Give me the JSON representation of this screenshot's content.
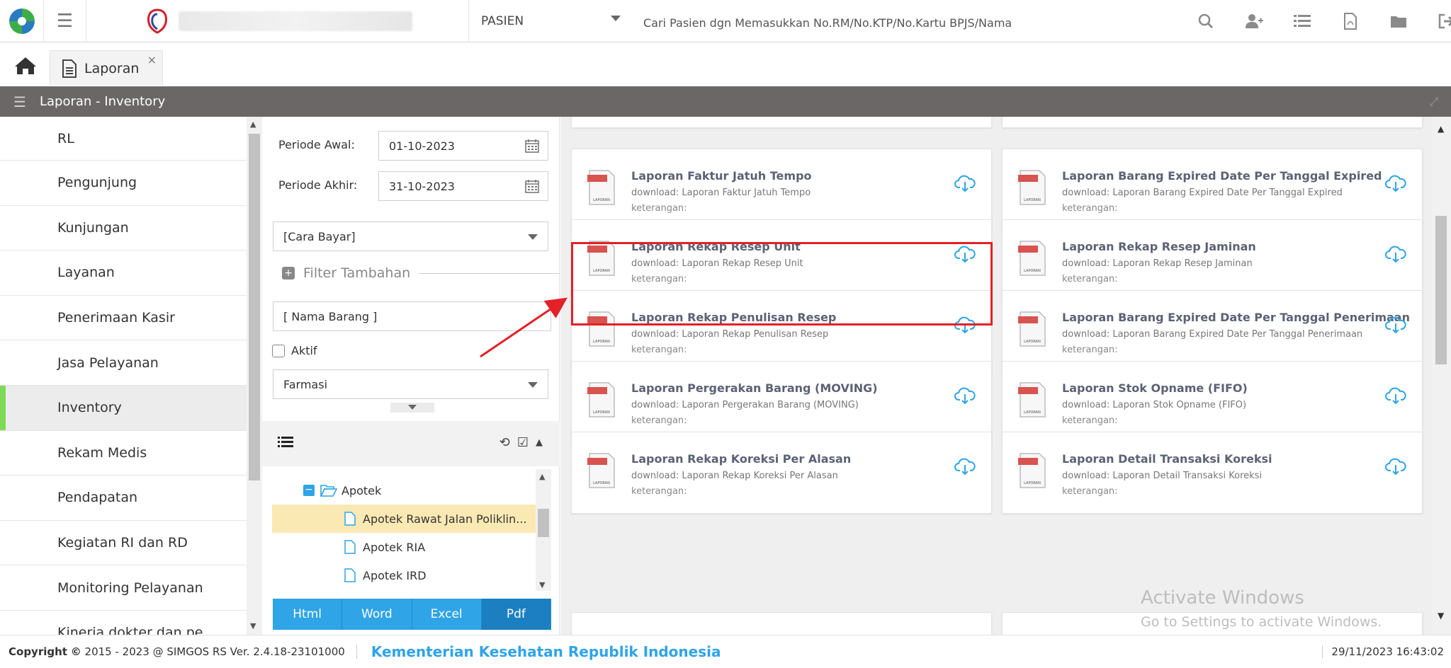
{
  "topbar": {
    "patient_select": "PASIEN",
    "search_placeholder": "Cari Pasien dgn Memasukkan No.RM/No.KTP/No.Kartu BPJS/Nama",
    "icons": [
      "search-icon",
      "add-user-icon",
      "list-icon",
      "pdf-file-icon",
      "folder-icon",
      "logout-icon"
    ]
  },
  "tabs": [
    {
      "label": "Laporan",
      "close": "×"
    }
  ],
  "section": {
    "title": "Laporan - Inventory"
  },
  "sidebar": {
    "items": [
      {
        "label": "RL"
      },
      {
        "label": "Pengunjung"
      },
      {
        "label": "Kunjungan"
      },
      {
        "label": "Layanan"
      },
      {
        "label": "Penerimaan Kasir"
      },
      {
        "label": "Jasa Pelayanan"
      },
      {
        "label": "Inventory"
      },
      {
        "label": "Rekam Medis"
      },
      {
        "label": "Pendapatan"
      },
      {
        "label": "Kegiatan RI dan RD"
      },
      {
        "label": "Monitoring Pelayanan"
      },
      {
        "label": "Kinerja dokter dan pe..."
      }
    ],
    "active": "Inventory"
  },
  "filter": {
    "periode_awal_label": "Periode Awal:",
    "periode_awal_value": "01-10-2023",
    "periode_akhir_label": "Periode Akhir:",
    "periode_akhir_value": "31-10-2023",
    "cara_bayar": "[Cara Bayar]",
    "filter_tambahan": "Filter Tambahan",
    "nama_barang_placeholder": "[ Nama Barang ]",
    "aktif_label": "Aktif",
    "farmasi": "Farmasi",
    "tree": [
      {
        "label": "Apotek",
        "type": "folder"
      },
      {
        "label": "Apotek Rawat Jalan Poliklin...",
        "type": "file",
        "selected": true
      },
      {
        "label": "Apotek RIA",
        "type": "file"
      },
      {
        "label": "Apotek IRD",
        "type": "file"
      }
    ],
    "buttons": [
      "Html",
      "Word",
      "Excel",
      "Pdf"
    ],
    "selected_button": "Pdf"
  },
  "reports": [
    {
      "title": "Laporan Faktur Jatuh Tempo",
      "download": "download: Laporan Faktur Jatuh Tempo",
      "note": "keterangan:"
    },
    {
      "title": "Laporan Barang Expired Date Per Tanggal Expired",
      "download": "download: Laporan Barang Expired Date Per Tanggal Expired",
      "note": "keterangan:"
    },
    {
      "title": "Laporan Rekap Resep Unit",
      "download": "download: Laporan Rekap Resep Unit",
      "note": "keterangan:"
    },
    {
      "title": "Laporan Rekap Resep Jaminan",
      "download": "download: Laporan Rekap Resep Jaminan",
      "note": "keterangan:"
    },
    {
      "title": "Laporan Rekap Penulisan Resep",
      "download": "download: Laporan Rekap Penulisan Resep",
      "note": "keterangan:"
    },
    {
      "title": "Laporan Barang Expired Date Per Tanggal Penerimaan",
      "download": "download: Laporan Barang Expired Date Per Tanggal Penerimaan",
      "note": "keterangan:"
    },
    {
      "title": "Laporan Pergerakan Barang (MOVING)",
      "download": "download: Laporan Pergerakan Barang (MOVING)",
      "note": "keterangan:"
    },
    {
      "title": "Laporan Stok Opname (FIFO)",
      "download": "download: Laporan Stok Opname (FIFO)",
      "note": "keterangan:"
    },
    {
      "title": "Laporan Rekap Koreksi Per Alasan",
      "download": "download: Laporan Rekap Koreksi Per Alasan",
      "note": "keterangan:"
    },
    {
      "title": "Laporan Detail Transaksi Koreksi",
      "download": "download: Laporan Detail Transaksi Koreksi",
      "note": "keterangan:"
    }
  ],
  "pdf_icon_label": "LAPORAN",
  "watermark": {
    "line1": "Activate Windows",
    "line2": "Go to Settings to activate Windows."
  },
  "footer": {
    "copyright": "Copyright",
    "copyright_text": "2015 - 2023 @ SIMGOS RS Ver. 2.4.18-23101000",
    "ministry": "Kementerian Kesehatan Republik Indonesia",
    "datetime": "29/11/2023 16:43:02"
  },
  "colors": {
    "accent_blue": "#2fa4e7",
    "section_bar": "#6b6767",
    "active_indicator": "#7ed957",
    "highlight_red": "#e32127"
  }
}
